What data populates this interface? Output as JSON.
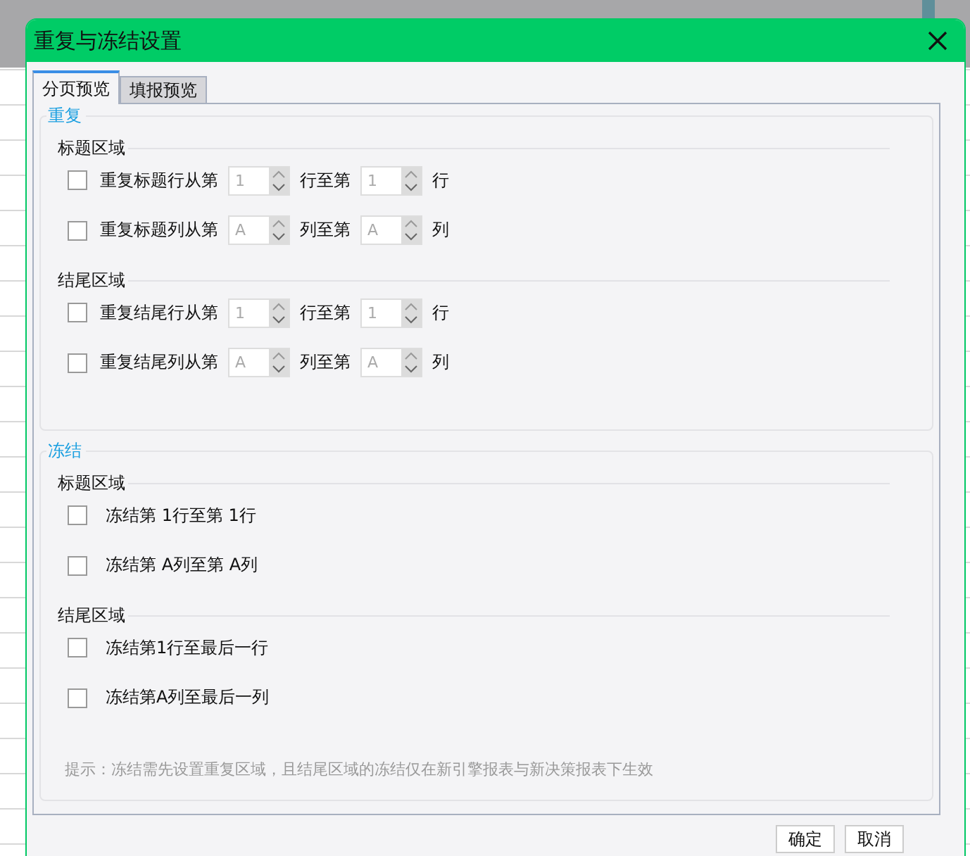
{
  "dialog": {
    "title": "重复与冻结设置"
  },
  "tabs": [
    {
      "label": "分页预览",
      "selected": true
    },
    {
      "label": "填报预览",
      "selected": false
    }
  ],
  "sections": [
    {
      "title": "重复",
      "groups": [
        {
          "title": "标题区域",
          "rows": [
            {
              "kind": "spinner",
              "checked": false,
              "label": "重复标题行从第",
              "from": "1",
              "mid": "行至第",
              "to": "1",
              "unit": "行"
            },
            {
              "kind": "spinner",
              "checked": false,
              "label": "重复标题列从第",
              "from": "A",
              "mid": "列至第",
              "to": "A",
              "unit": "列"
            }
          ]
        },
        {
          "title": "结尾区域",
          "rows": [
            {
              "kind": "spinner",
              "checked": false,
              "label": "重复结尾行从第",
              "from": "1",
              "mid": "行至第",
              "to": "1",
              "unit": "行"
            },
            {
              "kind": "spinner",
              "checked": false,
              "label": "重复结尾列从第",
              "from": "A",
              "mid": "列至第",
              "to": "A",
              "unit": "列"
            }
          ]
        }
      ]
    },
    {
      "title": "冻结",
      "groups": [
        {
          "title": "标题区域",
          "rows": [
            {
              "kind": "text",
              "checked": false,
              "label": "冻结第 1行至第 1行"
            },
            {
              "kind": "text",
              "checked": false,
              "label": "冻结第 A列至第 A列"
            }
          ]
        },
        {
          "title": "结尾区域",
          "rows": [
            {
              "kind": "text",
              "checked": false,
              "label": "冻结第1行至最后一行"
            },
            {
              "kind": "text",
              "checked": false,
              "label": "冻结第A列至最后一列"
            }
          ]
        }
      ],
      "hint": "提示：冻结需先设置重复区域，且结尾区域的冻结仅在新引擎报表与新决策报表下生效"
    }
  ],
  "buttons": [
    "确定",
    "取消"
  ]
}
